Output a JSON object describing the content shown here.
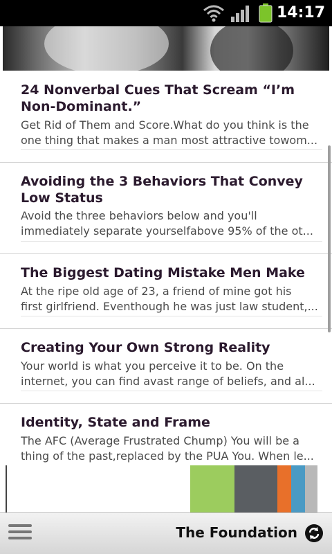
{
  "status_bar": {
    "time": "14:17"
  },
  "articles": [
    {
      "title": "24 Nonverbal Cues That Scream “I’m Non-Dominant.”",
      "summary_lines": [
        "Get Rid of Them and Score.What do you think is the",
        "one thing that makes a man most attractive towom..."
      ]
    },
    {
      "title": "Avoiding the 3 Behaviors That Convey Low Status",
      "summary_lines": [
        "Avoid the three behaviors below and you'll",
        "immediately separate yourselfabove 95% of the ot..."
      ]
    },
    {
      "title": "The Biggest Dating Mistake Men Make",
      "summary_lines": [
        "At the ripe old age of 23, a friend of mine got his",
        "first girlfriend. Eventhough he was just law student,..."
      ]
    },
    {
      "title": "Creating Your Own Strong Reality",
      "summary_lines": [
        "Your world is what you perceive it to be. On the",
        "internet, you can find avast range of beliefs, and al..."
      ]
    },
    {
      "title": "Identity, State and Frame",
      "summary_lines": [
        "The AFC (Average Frustrated Chump) You will be a",
        "thing of the past,replaced by the PUA You. When le..."
      ]
    }
  ],
  "banner": {
    "colors": [
      "#9ccc5e",
      "#5a5e62",
      "#e8702a",
      "#4a9ac4",
      "#b8b8b8"
    ]
  },
  "bottom_bar": {
    "title": "The Foundation",
    "menu_icon": "menu-icon",
    "refresh_icon": "refresh-icon"
  },
  "colors": {
    "title_text": "#2b1a2e",
    "summary_text": "#4a4a4a",
    "status_bar_bg": "#000000",
    "battery": "#7cc42a"
  }
}
